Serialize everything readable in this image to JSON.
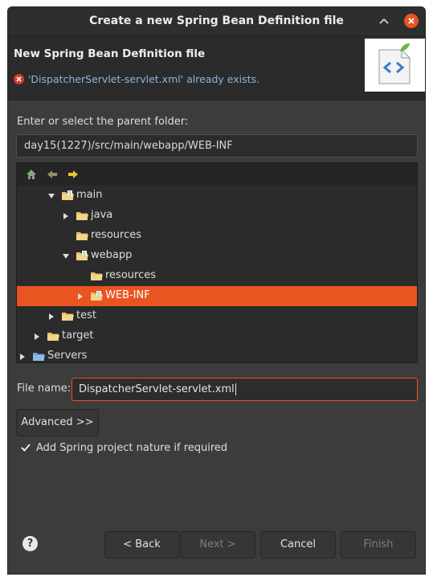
{
  "window": {
    "title": "Create a new Spring Bean Definition file"
  },
  "header": {
    "title": "New Spring Bean Definition file",
    "error_message": "'DispatcherServlet-servlet.xml' already exists."
  },
  "parent_folder": {
    "label": "Enter or select the parent folder:",
    "value": "day15(1227)/src/main/webapp/WEB-INF"
  },
  "tree": {
    "toolbar": [
      "home-icon",
      "back-arrow-icon",
      "forward-arrow-icon"
    ],
    "rows": [
      {
        "label": "main",
        "expander": "down",
        "selected": false
      },
      {
        "label": "java",
        "expander": "right",
        "selected": false
      },
      {
        "label": "resources",
        "expander": "none",
        "selected": false
      },
      {
        "label": "webapp",
        "expander": "down",
        "selected": false
      },
      {
        "label": "resources",
        "expander": "none",
        "selected": false
      },
      {
        "label": "WEB-INF",
        "expander": "right",
        "selected": true
      },
      {
        "label": "test",
        "expander": "right",
        "selected": false
      },
      {
        "label": "target",
        "expander": "right",
        "selected": false
      },
      {
        "label": "Servers",
        "expander": "right",
        "selected": false
      }
    ]
  },
  "file_name": {
    "label": "File name:",
    "value": "DispatcherServlet-servlet.xml"
  },
  "advanced_button": "Advanced >>",
  "nature_checkbox": {
    "label": "Add Spring project nature if required",
    "checked": true
  },
  "footer": {
    "help": "?",
    "back": "< Back",
    "next": "Next >",
    "cancel": "Cancel",
    "finish": "Finish"
  },
  "colors": {
    "accent": "#e95420",
    "dialog_bg": "#3c3c3c",
    "header_bg": "#2b2b2b",
    "error": "#d33a2c",
    "error_text": "#8fb6d8"
  }
}
